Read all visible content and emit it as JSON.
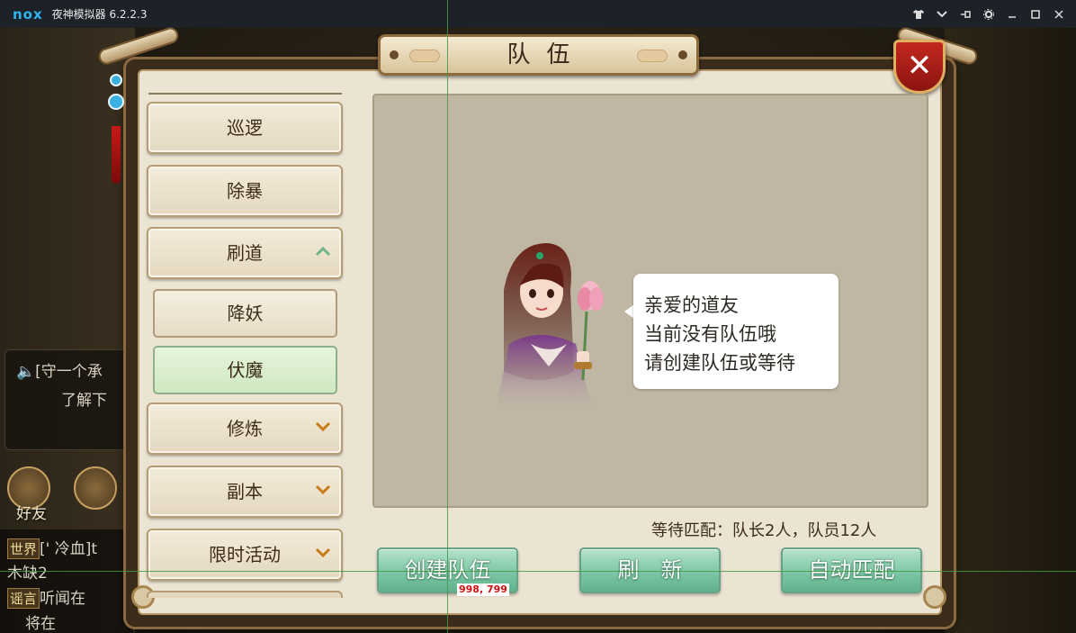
{
  "emulator": {
    "logo": "nox",
    "title": "夜神模拟器 6.2.2.3",
    "icons": [
      "shirt-icon",
      "chevron-down-icon",
      "pin-icon",
      "gear-icon",
      "minimize-icon",
      "maximize-icon",
      "close-icon"
    ]
  },
  "background_chat": {
    "line1": "[守一个承",
    "line2": "了解下",
    "friend_label": "好友",
    "world_tag": "世界",
    "world_text": "[' 冷血]t",
    "world_text2": "木缺2",
    "rumor_tag": "谣言",
    "rumor_text": "听闻在",
    "rumor_text2": "将在"
  },
  "dialog": {
    "title": "队伍",
    "close_label": "✕"
  },
  "menu": {
    "items": [
      {
        "label": "巡逻"
      },
      {
        "label": "除暴"
      },
      {
        "label": "刷道",
        "expanded": true
      },
      {
        "label": "修炼"
      },
      {
        "label": "副本"
      },
      {
        "label": "限时活动"
      }
    ],
    "sub_items": [
      {
        "label": "降妖",
        "selected": false
      },
      {
        "label": "伏魔",
        "selected": true
      }
    ]
  },
  "content": {
    "bubble": {
      "line1": "亲爱的道友",
      "line2": "当前没有队伍哦",
      "line3": "请创建队伍或等待"
    },
    "wait_status": "等待匹配：队长2人，队员12人",
    "buttons": {
      "create": "创建队伍",
      "refresh": "刷　新",
      "auto_match": "自动匹配"
    }
  },
  "overlay": {
    "coord": "998, 799"
  },
  "colors": {
    "panel": "#ece4d3",
    "action_button": "#7cc7a4",
    "selected_sub": "#cfe8c2",
    "close_red": "#c2281e"
  }
}
